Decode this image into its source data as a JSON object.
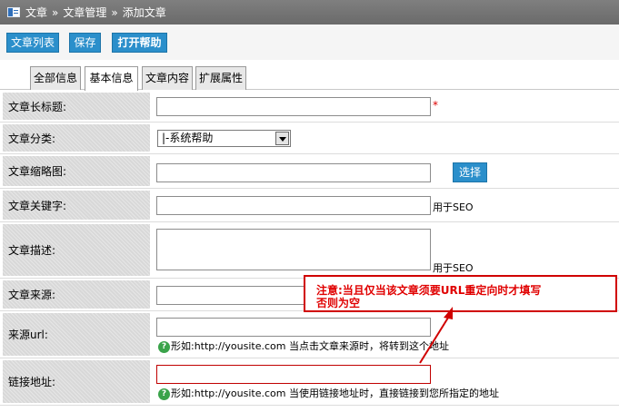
{
  "breadcrumb": {
    "items": [
      "文章",
      "文章管理",
      "添加文章"
    ],
    "separator": "»"
  },
  "toolbar": {
    "list_label": "文章列表",
    "save_label": "保存",
    "help_label": "打开帮助"
  },
  "tabs": [
    "全部信息",
    "基本信息",
    "文章内容",
    "扩展属性"
  ],
  "active_tab": "基本信息",
  "form": {
    "title_label": "文章长标题:",
    "title_required": "*",
    "category_label": "文章分类:",
    "category_value": "|-系统帮助",
    "thumb_label": "文章缩略图:",
    "thumb_button": "选择",
    "keywords_label": "文章关键字:",
    "keywords_hint": "用于SEO",
    "desc_label": "文章描述:",
    "desc_hint": "用于SEO",
    "source_label": "文章来源:",
    "source_url_label": "来源url:",
    "source_url_hint": "形如:http://yousite.com 当点击文章来源时，将转到这个地址",
    "link_label": "链接地址:",
    "link_hint": "形如:http://yousite.com 当使用链接地址时，直接链接到您所指定的地址"
  },
  "annotation": {
    "line1": "注意:当且仅当该文章须要URL重定向时才填写",
    "line2": "否则为空",
    "color": "#e00000"
  },
  "colors": {
    "accent": "#2b8fcb",
    "title_bar": "#737373",
    "label_bg": "#d8d8d8"
  }
}
